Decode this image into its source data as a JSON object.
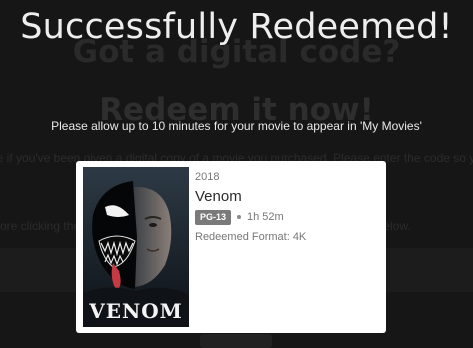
{
  "background": {
    "heading_1": "Got a digital code?",
    "heading_2": "Redeem it now!",
    "line_1": "ee if you've been given a digital copy of a movie you purchased. Please enter the code so you ca",
    "line_2": "efore clicking the Redeem button, please accept the Terms & Conditions below."
  },
  "dialog": {
    "title": "Successfully Redeemed!",
    "notice": "Please allow up to 10 minutes for your movie to appear in 'My Movies'"
  },
  "movie": {
    "year": "2018",
    "title": "Venom",
    "rating": "PG-13",
    "runtime": "1h 52m",
    "format_label": "Redeemed Format: 4K",
    "poster_logo": "VENOM"
  },
  "colors": {
    "background": "#161616",
    "card": "#ffffff",
    "rating_badge": "#7a7a7a"
  }
}
